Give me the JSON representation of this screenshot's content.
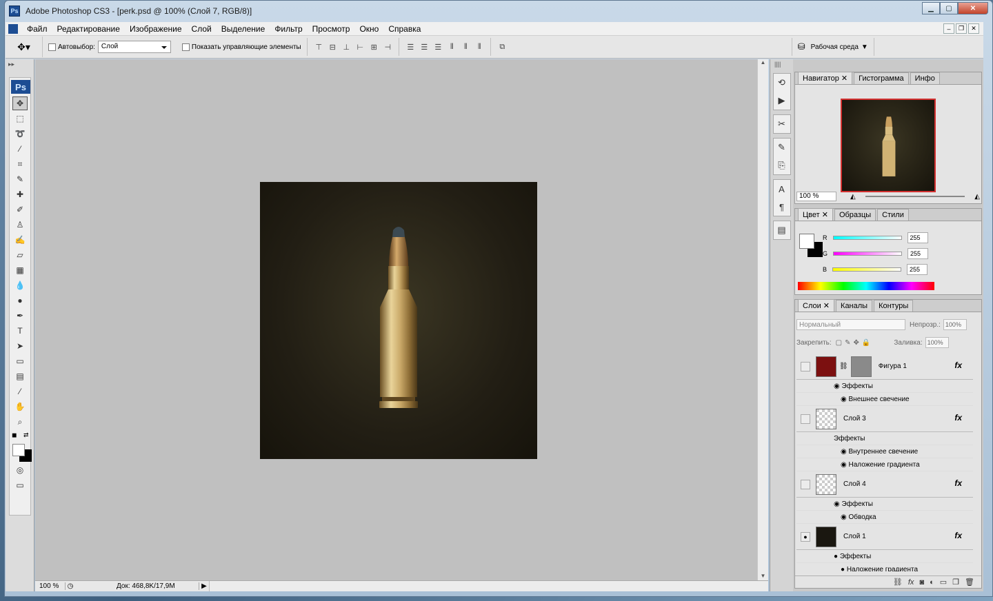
{
  "window": {
    "title": "Adobe Photoshop CS3 - [perk.psd @ 100% (Слой 7, RGB/8)]",
    "app_icon": "Ps"
  },
  "menu": [
    "Файл",
    "Редактирование",
    "Изображение",
    "Слой",
    "Выделение",
    "Фильтр",
    "Просмотр",
    "Окно",
    "Справка"
  ],
  "options": {
    "autoselect_label": "Автовыбор:",
    "autoselect_value": "Слой",
    "show_controls_label": "Показать управляющие элементы",
    "workspace_label": "Рабочая среда"
  },
  "toolbox": {
    "logo": "Ps"
  },
  "status": {
    "zoom": "100 %",
    "doc": "Док: 468,8K/17,9M"
  },
  "navigator": {
    "tabs": [
      "Навигатор",
      "Гистограмма",
      "Инфо"
    ],
    "zoom": "100 %"
  },
  "color": {
    "tabs": [
      "Цвет",
      "Образцы",
      "Стили"
    ],
    "r_label": "R",
    "g_label": "G",
    "b_label": "B",
    "r": "255",
    "g": "255",
    "b": "255"
  },
  "layers": {
    "tabs": [
      "Слои",
      "Каналы",
      "Контуры"
    ],
    "blend": "Нормальный",
    "opacity_label": "Непрозр.:",
    "opacity": "100%",
    "lock_label": "Закрепить:",
    "fill_label": "Заливка:",
    "fill": "100%",
    "items": [
      {
        "name": "Фигура 1",
        "effects_label": "Эффекты",
        "effects": [
          "Внешнее свечение"
        ]
      },
      {
        "name": "Слой 3",
        "effects_label": "Эффекты",
        "effects": [
          "Внутреннее свечение",
          "Наложение градиента"
        ]
      },
      {
        "name": "Слой 4",
        "effects_label": "Эффекты",
        "effects": [
          "Обводка"
        ]
      },
      {
        "name": "Слой 1",
        "effects_label": "Эффекты",
        "effects": [
          "Наложение градиента"
        ]
      }
    ],
    "fx": "fx"
  },
  "colors": {
    "accent": "#1d4d93",
    "nav_border": "#d43030",
    "canvas": "#c0c0c0"
  }
}
